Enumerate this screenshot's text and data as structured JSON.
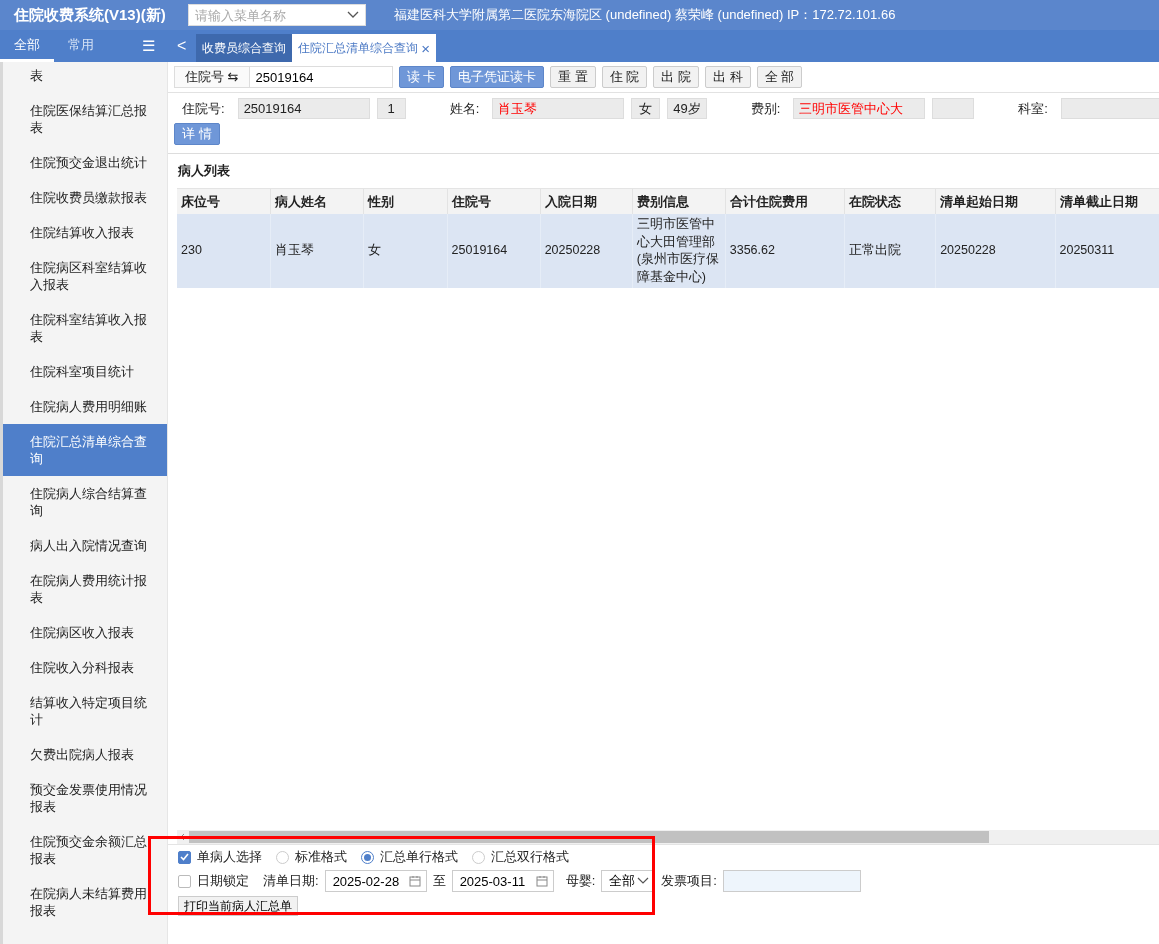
{
  "header": {
    "title": "住院收费系统(V13)(新)",
    "menu_search": {
      "placeholder": "请输入菜单名称"
    },
    "info": "福建医科大学附属第二医院东海院区 (undefined) 蔡荣峰 (undefined) IP：172.72.101.66"
  },
  "sidebar": {
    "tabs": [
      {
        "label": "全部",
        "selected": true
      },
      {
        "label": "常用",
        "selected": false
      }
    ],
    "menu_toggle": "☰",
    "items": [
      {
        "label": "表",
        "selected": false
      },
      {
        "label": "住院医保结算汇总报表",
        "selected": false
      },
      {
        "label": "住院预交金退出统计",
        "selected": false
      },
      {
        "label": "住院收费员缴款报表",
        "selected": false
      },
      {
        "label": "住院结算收入报表",
        "selected": false
      },
      {
        "label": "住院病区科室结算收入报表",
        "selected": false
      },
      {
        "label": "住院科室结算收入报表",
        "selected": false
      },
      {
        "label": "住院科室项目统计",
        "selected": false
      },
      {
        "label": "住院病人费用明细账",
        "selected": false
      },
      {
        "label": "住院汇总清单综合查询",
        "selected": true
      },
      {
        "label": "住院病人综合结算查询",
        "selected": false
      },
      {
        "label": "病人出入院情况查询",
        "selected": false
      },
      {
        "label": "在院病人费用统计报表",
        "selected": false
      },
      {
        "label": "住院病区收入报表",
        "selected": false
      },
      {
        "label": "住院收入分科报表",
        "selected": false
      },
      {
        "label": "结算收入特定项目统计",
        "selected": false
      },
      {
        "label": "欠费出院病人报表",
        "selected": false
      },
      {
        "label": "预交金发票使用情况报表",
        "selected": false
      },
      {
        "label": "住院预交金余额汇总报表",
        "selected": false
      },
      {
        "label": "在院病人未结算费用报表",
        "selected": false
      }
    ]
  },
  "tabs": {
    "back": "<",
    "items": [
      {
        "label": "收费员综合查询",
        "selected": false,
        "closable": false
      },
      {
        "label": "住院汇总清单综合查询",
        "selected": true,
        "closable": true
      }
    ],
    "close": "×"
  },
  "search_bar": {
    "type_label": "住院号 ⇆",
    "value": "25019164",
    "buttons": [
      {
        "label": "读 卡",
        "kind": "primary"
      },
      {
        "label": "电子凭证读卡",
        "kind": "primary"
      },
      {
        "label": "重 置",
        "kind": "plain"
      },
      {
        "label": "住 院",
        "kind": "plain"
      },
      {
        "label": "出 院",
        "kind": "plain"
      },
      {
        "label": "出 科",
        "kind": "plain"
      },
      {
        "label": "全 部",
        "kind": "plain"
      }
    ]
  },
  "patient_info": {
    "fields": [
      {
        "label": "住院号:",
        "values": [
          {
            "text": "25019164"
          },
          {
            "text": "1"
          }
        ]
      },
      {
        "label": "姓名:",
        "values": [
          {
            "text": "肖玉琴",
            "highlighted": true
          },
          {
            "text": "女"
          },
          {
            "text": "49岁"
          }
        ]
      },
      {
        "label": "费别:",
        "values": [
          {
            "text": "三明市医管中心大",
            "highlighted": true
          }
        ]
      },
      {
        "label": "科室:"
      }
    ],
    "detail_button": "详 情"
  },
  "patient_list": {
    "title": "病人列表",
    "columns": [
      "床位号",
      "病人姓名",
      "性别",
      "住院号",
      "入院日期",
      "费别信息",
      "合计住院费用",
      "在院状态",
      "清单起始日期",
      "清单截止日期"
    ],
    "rows": [
      {
        "selected": true,
        "cells": [
          "230",
          "肖玉琴",
          "女",
          "25019164",
          "20250228",
          "三明市医管中心大田管理部(泉州市医疗保障基金中心)",
          "3356.62",
          "正常出院",
          "20250228",
          "20250311"
        ]
      }
    ]
  },
  "options": {
    "single_patient": {
      "label": "单病人选择",
      "checked": true
    },
    "formats": [
      {
        "label": "标准格式",
        "selected": false
      },
      {
        "label": "汇总单行格式",
        "selected": true
      },
      {
        "label": "汇总双行格式",
        "selected": false
      }
    ],
    "date_lock": {
      "label": "日期锁定",
      "checked": false
    },
    "date_label": "清单日期:",
    "date_from": "2025-02-28",
    "date_sep": "至",
    "date_to": "2025-03-11",
    "mother_baby": {
      "label": "母婴:",
      "value": "全部"
    },
    "invoice_item": {
      "label": "发票项目:"
    },
    "print_button": "打印当前病人汇总单"
  }
}
